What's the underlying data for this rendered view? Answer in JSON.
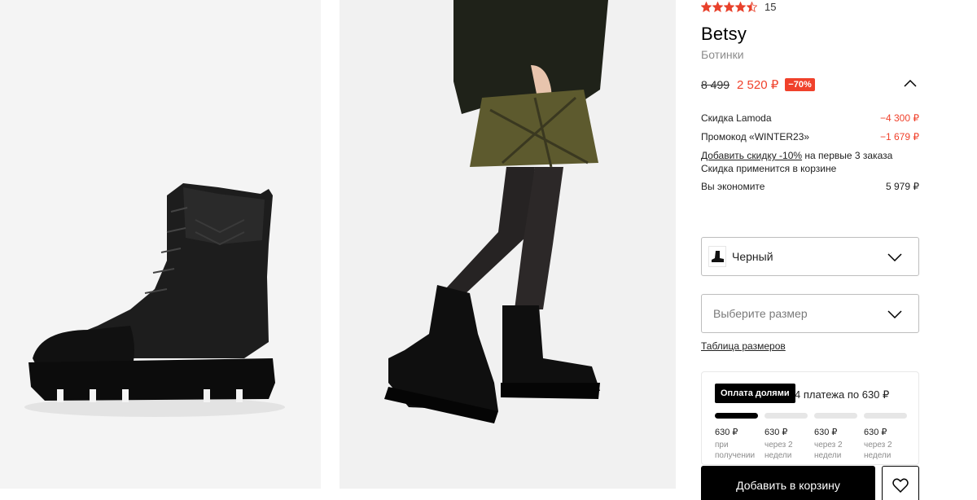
{
  "rating": {
    "value": 4.5,
    "count": "15"
  },
  "product": {
    "brand": "Betsy",
    "category": "Ботинки"
  },
  "price": {
    "old": "8 499",
    "new": "2 520 ₽",
    "discount": "−70%"
  },
  "breakdown": {
    "lamoda_label": "Скидка Lamoda",
    "lamoda_value": "−4 300 ₽",
    "promo_label": "Промокод «WINTER23»",
    "promo_value": "−1 679 ₽",
    "extra_link": "Добавить скидку -10%",
    "extra_suffix": " на первые 3 заказа",
    "extra_note": "Скидка применится в корзине",
    "save_label": "Вы экономите",
    "save_value": "5 979 ₽"
  },
  "color_select": {
    "value": "Черный"
  },
  "size_select": {
    "placeholder": "Выберите размер"
  },
  "size_table_link": "Таблица размеров",
  "installment": {
    "badge": "Оплата долями",
    "text": "4 платежа по 630 ₽",
    "payments": [
      {
        "amount": "630 ₽",
        "when": "при получении"
      },
      {
        "amount": "630 ₽",
        "when": "через 2 недели"
      },
      {
        "amount": "630 ₽",
        "when": "через 2 недели"
      },
      {
        "amount": "630 ₽",
        "when": "через 2 недели"
      }
    ]
  },
  "buttons": {
    "add_to_cart": "Добавить в корзину"
  },
  "colors": {
    "accent_red": "#f0412b",
    "star": "#e8412b"
  },
  "icons": [
    "star-icon",
    "chevron-up-icon",
    "chevron-down-icon",
    "heart-icon",
    "boot-thumbnail"
  ]
}
